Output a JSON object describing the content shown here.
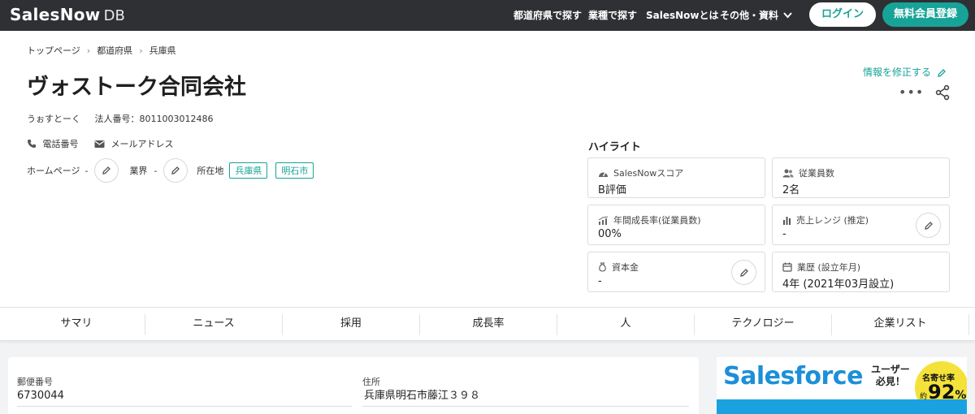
{
  "header": {
    "logo_main": "SalesNow",
    "logo_sub": "DB",
    "nav": {
      "prefecture": "都道府県で探す",
      "industry": "業種で探す",
      "about": "SalesNowとは",
      "other": "その他・資料"
    },
    "login_label": "ログイン",
    "signup_label": "無料会員登録"
  },
  "breadcrumb": [
    "トップページ",
    "都道府県",
    "兵庫県"
  ],
  "company": {
    "name": "ヴォストーク合同会社",
    "kana": "うぉすとーく",
    "corp_number_label": "法人番号：",
    "corp_number": "8011003012486",
    "phone_label": "電話番号",
    "email_label": "メールアドレス",
    "homepage_label": "ホームページ",
    "homepage_value": "-",
    "industry_label": "業界",
    "industry_value": "-",
    "location_label": "所在地",
    "location_tags": [
      "兵庫県",
      "明石市"
    ],
    "edit_link": "情報を修正する"
  },
  "highlight": {
    "title": "ハイライト",
    "cards": [
      {
        "label": "SalesNowスコア",
        "value": "B評価",
        "icon": "gauge-icon"
      },
      {
        "label": "従業員数",
        "value": "2名",
        "icon": "people-icon"
      },
      {
        "label": "年間成長率(従業員数)",
        "value": "00%",
        "icon": "growth-icon"
      },
      {
        "label": "売上レンジ (推定)",
        "value": "-",
        "icon": "bar-chart-icon"
      },
      {
        "label": "資本金",
        "value": "-",
        "icon": "money-bag-icon"
      },
      {
        "label": "業歴 (設立年月)",
        "value": "4年 (2021年03月設立)",
        "icon": "calendar-icon"
      }
    ]
  },
  "tabs": [
    "サマリ",
    "ニュース",
    "採用",
    "成長率",
    "人",
    "テクノロジー",
    "企業リスト"
  ],
  "details": {
    "postal_label": "郵便番号",
    "postal_value": "6730044",
    "address_label": "住所",
    "address_value": "兵庫県明石市藤江３９８"
  },
  "ad": {
    "brand": "Salesforce",
    "tagline_1": "ユーザー",
    "tagline_2": "必見！",
    "badge_top": "名寄せ率",
    "badge_prefix": "約",
    "badge_value": "92",
    "badge_unit": "%"
  },
  "colors": {
    "accent": "#17a398",
    "topbar": "#2f3033",
    "ad_blue": "#1c8fd8",
    "ad_badge": "#f4e23b"
  }
}
